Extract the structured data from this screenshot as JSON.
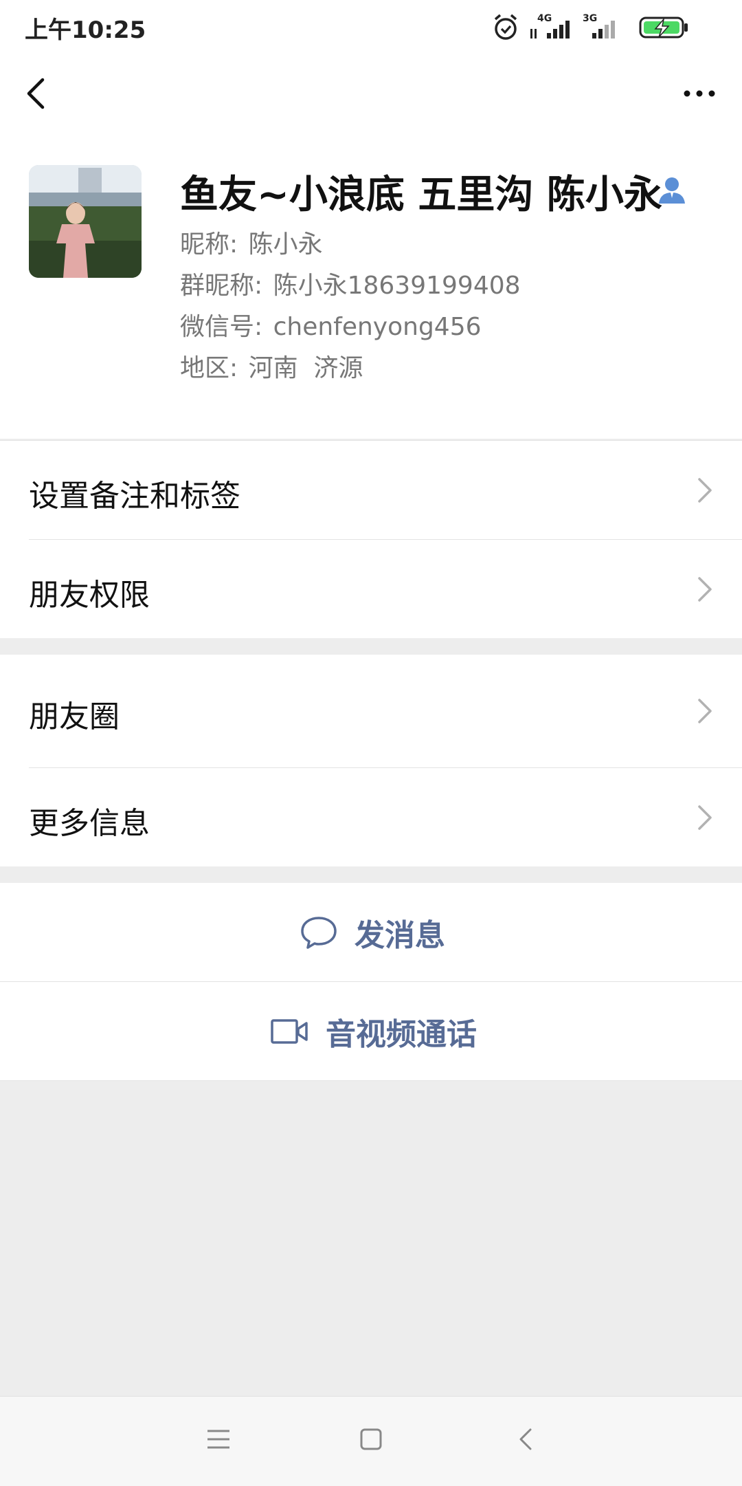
{
  "status_bar": {
    "time": "上午10:25",
    "network_1": "4G",
    "network_2": "3G"
  },
  "nav": {
    "back_icon": "back-chevron-icon",
    "more_icon": "more-dots-icon"
  },
  "profile": {
    "display_name": "鱼友~小浪底 五里沟 陈小永",
    "nickname_label": "昵称:",
    "nickname": "陈小永",
    "group_nickname_label": "群昵称:",
    "group_nickname": "陈小永18639199408",
    "wechat_id_label": "微信号:",
    "wechat_id": "chenfenyong456",
    "region_label": "地区:",
    "region": "河南  济源"
  },
  "menu": {
    "set_remark": "设置备注和标签",
    "friend_permissions": "朋友权限",
    "moments": "朋友圈",
    "more_info": "更多信息"
  },
  "actions": {
    "send_message": "发消息",
    "video_call": "音视频通话"
  },
  "colors": {
    "link_blue": "#576b95",
    "battery_green": "#4cd964",
    "background": "#ededed"
  }
}
